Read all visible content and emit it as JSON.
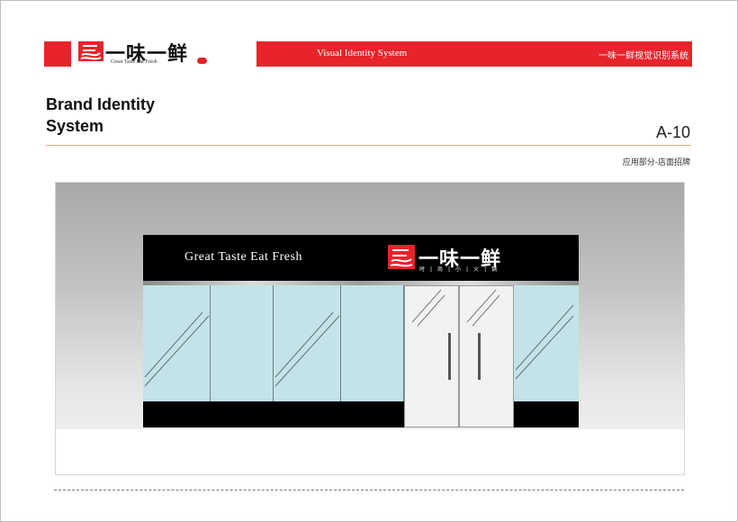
{
  "header": {
    "logo_cn": "一味一鲜",
    "logo_en": "Great Taste Eat Fresh",
    "title_en": "Visual Identity System",
    "title_cn": "一味一鲜视觉识别系统",
    "accent_color": "#e8232b"
  },
  "page": {
    "brand_title_line1": "Brand Identity",
    "brand_title_line2": "System",
    "code": "A-10",
    "section": "应用部分-店面招牌"
  },
  "storefront": {
    "slogan": "Great Taste Eat Fresh",
    "sign_cn": "一味一鲜",
    "sign_sub": "时|尚|小|火|锅"
  }
}
